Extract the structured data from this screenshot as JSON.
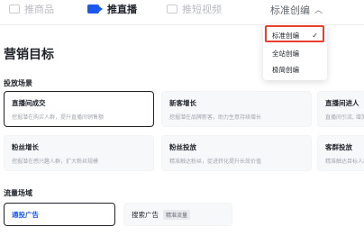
{
  "tabs": [
    {
      "label": "推商品",
      "icon": "goods-icon",
      "active": false
    },
    {
      "label": "推直播",
      "icon": "live-icon",
      "active": true
    },
    {
      "label": "推短视频",
      "icon": "video-icon",
      "active": false
    }
  ],
  "mode_selector": {
    "label": "标准创编",
    "icon": "chevron-up-icon"
  },
  "page_title": "营销目标",
  "scene_section": {
    "label": "投放场景",
    "cards": [
      {
        "title": "直播间成交",
        "desc": "挖掘潜在购买人群，提升直播间销售额"
      },
      {
        "title": "新客增长",
        "desc": "挖掘潜在品牌新客，助力生意持续增长"
      },
      {
        "title": "直播间进人",
        "desc": "直播间引流, 增加进入优质"
      },
      {
        "title": "粉丝增长",
        "desc": "挖掘潜在感兴趣人群，扩大粉丝规模"
      },
      {
        "title": "粉丝投放",
        "desc": "精准触达粉丝，促进转化提升长效价值"
      },
      {
        "title": "客群投放",
        "desc": "精准触达目标人群"
      }
    ]
  },
  "flow_section": {
    "label": "流量场域",
    "general": {
      "label": "通投广告"
    },
    "search": {
      "label": "搜索广告",
      "tag": "精准流量"
    }
  },
  "dropdown": {
    "items": [
      {
        "label": "标准创编",
        "selected": true,
        "check": "✓"
      },
      {
        "label": "全站创编",
        "selected": false
      },
      {
        "label": "极简创编",
        "selected": false
      }
    ]
  },
  "colors": {
    "accent": "#1c58f0",
    "highlight": "#e8402f"
  }
}
